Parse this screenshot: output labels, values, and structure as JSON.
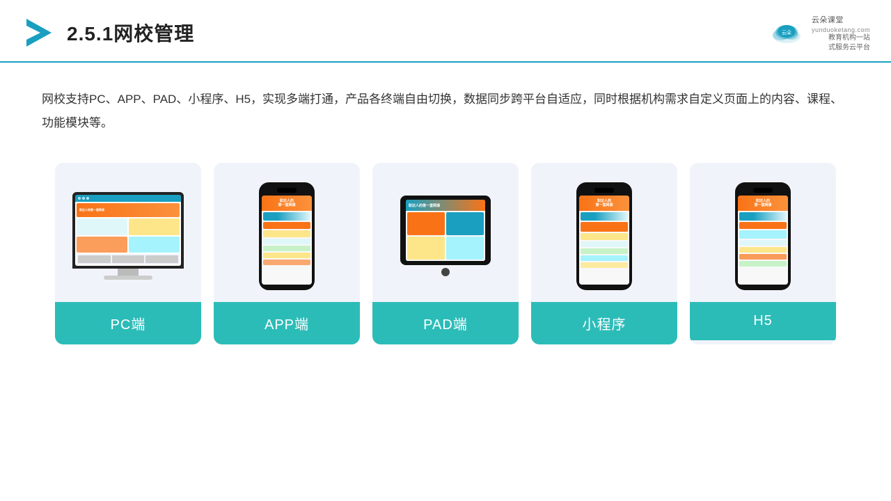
{
  "header": {
    "title": "2.5.1网校管理",
    "brand": {
      "name": "云朵课堂",
      "url": "yunduoketang.com",
      "slogan": "教育机构一站\n式服务云平台"
    }
  },
  "description": "网校支持PC、APP、PAD、小程序、H5，实现多端打通，产品各终端自由切换，数据同步跨平台自适应，同时根据机构需求自定义页面上的内容、课程、功能模块等。",
  "cards": [
    {
      "id": "pc",
      "label": "PC端"
    },
    {
      "id": "app",
      "label": "APP端"
    },
    {
      "id": "pad",
      "label": "PAD端"
    },
    {
      "id": "miniapp",
      "label": "小程序"
    },
    {
      "id": "h5",
      "label": "H5"
    }
  ]
}
